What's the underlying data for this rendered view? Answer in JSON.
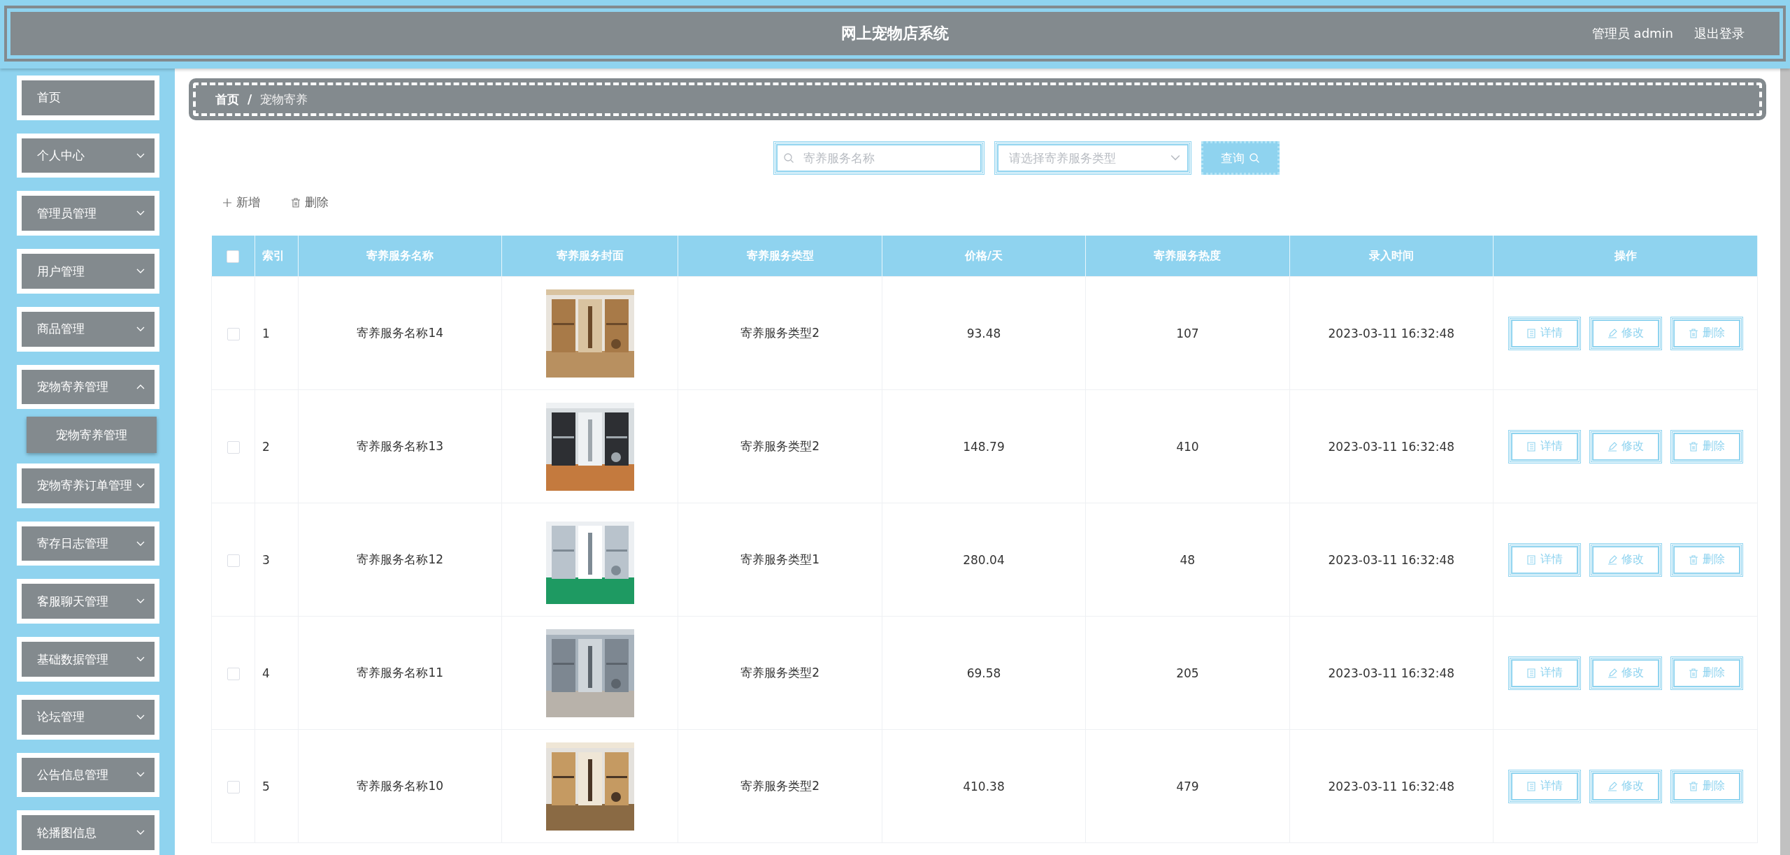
{
  "header": {
    "title": "网上宠物店系统",
    "user": "管理员 admin",
    "logout": "退出登录"
  },
  "sidebar": {
    "items": [
      {
        "label": "首页",
        "kind": "link",
        "expanded": false
      },
      {
        "label": "个人中心",
        "kind": "submenu",
        "expanded": false
      },
      {
        "label": "管理员管理",
        "kind": "submenu",
        "expanded": false
      },
      {
        "label": "用户管理",
        "kind": "submenu",
        "expanded": false
      },
      {
        "label": "商品管理",
        "kind": "submenu",
        "expanded": false
      },
      {
        "label": "宠物寄养管理",
        "kind": "submenu",
        "expanded": true,
        "children": [
          {
            "label": "宠物寄养管理"
          }
        ]
      },
      {
        "label": "宠物寄养订单管理",
        "kind": "submenu",
        "expanded": false
      },
      {
        "label": "寄存日志管理",
        "kind": "submenu",
        "expanded": false
      },
      {
        "label": "客服聊天管理",
        "kind": "submenu",
        "expanded": false
      },
      {
        "label": "基础数据管理",
        "kind": "submenu",
        "expanded": false
      },
      {
        "label": "论坛管理",
        "kind": "submenu",
        "expanded": false
      },
      {
        "label": "公告信息管理",
        "kind": "submenu",
        "expanded": false
      },
      {
        "label": "轮播图信息",
        "kind": "submenu",
        "expanded": false
      }
    ]
  },
  "breadcrumb": {
    "items": [
      "首页",
      "宠物寄养"
    ],
    "separator": "/"
  },
  "search": {
    "name_placeholder": "寄养服务名称",
    "type_placeholder": "请选择寄养服务类型",
    "button": "查询"
  },
  "toolbar": {
    "add": "新增",
    "delete": "删除"
  },
  "table": {
    "select_all_checked": false,
    "columns": [
      "索引",
      "寄养服务名称",
      "寄养服务封面",
      "寄养服务类型",
      "价格/天",
      "寄养服务热度",
      "录入时间",
      "操作"
    ],
    "rows": [
      {
        "checked": false,
        "index": "1",
        "name": "寄养服务名称14",
        "type": "寄养服务类型2",
        "price": "93.48",
        "heat": "107",
        "time": "2023-03-11 16:32:48",
        "actions": [
          "详情",
          "修改",
          "删除"
        ]
      },
      {
        "checked": false,
        "index": "2",
        "name": "寄养服务名称13",
        "type": "寄养服务类型2",
        "price": "148.79",
        "heat": "410",
        "time": "2023-03-11 16:32:48",
        "actions": [
          "详情",
          "修改",
          "删除"
        ]
      },
      {
        "checked": false,
        "index": "3",
        "name": "寄养服务名称12",
        "type": "寄养服务类型1",
        "price": "280.04",
        "heat": "48",
        "time": "2023-03-11 16:32:48",
        "actions": [
          "详情",
          "修改",
          "删除"
        ]
      },
      {
        "checked": false,
        "index": "4",
        "name": "寄养服务名称11",
        "type": "寄养服务类型2",
        "price": "69.58",
        "heat": "205",
        "time": "2023-03-11 16:32:48",
        "actions": [
          "详情",
          "修改",
          "删除"
        ]
      },
      {
        "checked": false,
        "index": "5",
        "name": "寄养服务名称10",
        "type": "寄养服务类型2",
        "price": "410.38",
        "heat": "479",
        "time": "2023-03-11 16:32:48",
        "actions": [
          "详情",
          "修改",
          "删除"
        ]
      }
    ]
  }
}
